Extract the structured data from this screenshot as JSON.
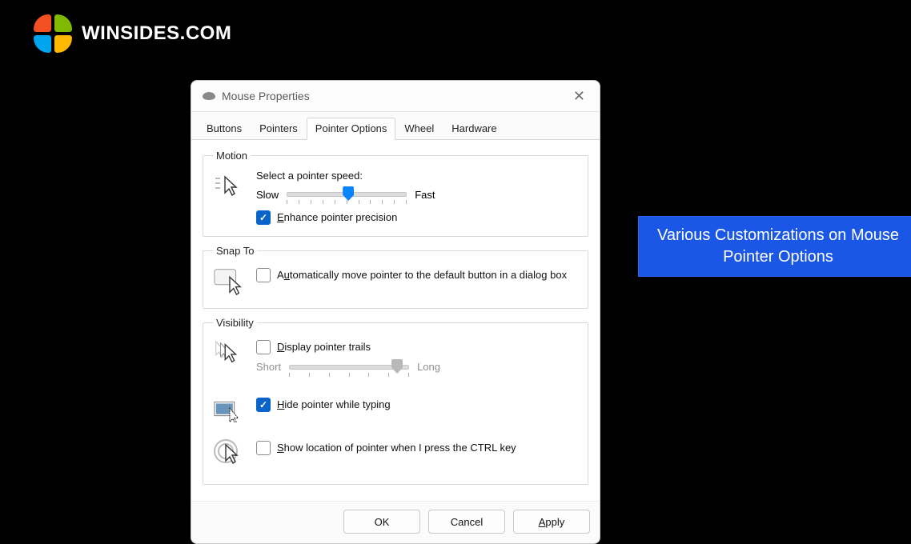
{
  "logo_text": "WINSIDES.COM",
  "dialog": {
    "title": "Mouse Properties",
    "tabs": [
      "Buttons",
      "Pointers",
      "Pointer Options",
      "Wheel",
      "Hardware"
    ],
    "active_tab": "Pointer Options",
    "motion": {
      "legend": "Motion",
      "speed_label": "Select a pointer speed:",
      "slow": "Slow",
      "fast": "Fast",
      "enhance": "Enhance pointer precision",
      "enhance_checked": true
    },
    "snapto": {
      "legend": "Snap To",
      "auto": "Automatically move pointer to the default button in a dialog box",
      "auto_checked": false
    },
    "visibility": {
      "legend": "Visibility",
      "trails": "Display pointer trails",
      "trails_checked": false,
      "short": "Short",
      "long": "Long",
      "hide": "Hide pointer while typing",
      "hide_checked": true,
      "ctrl": "Show location of pointer when I press the CTRL key",
      "ctrl_checked": false
    },
    "buttons": {
      "ok": "OK",
      "cancel": "Cancel",
      "apply": "Apply"
    }
  },
  "callout": "Various Customizations on Mouse Pointer Options"
}
